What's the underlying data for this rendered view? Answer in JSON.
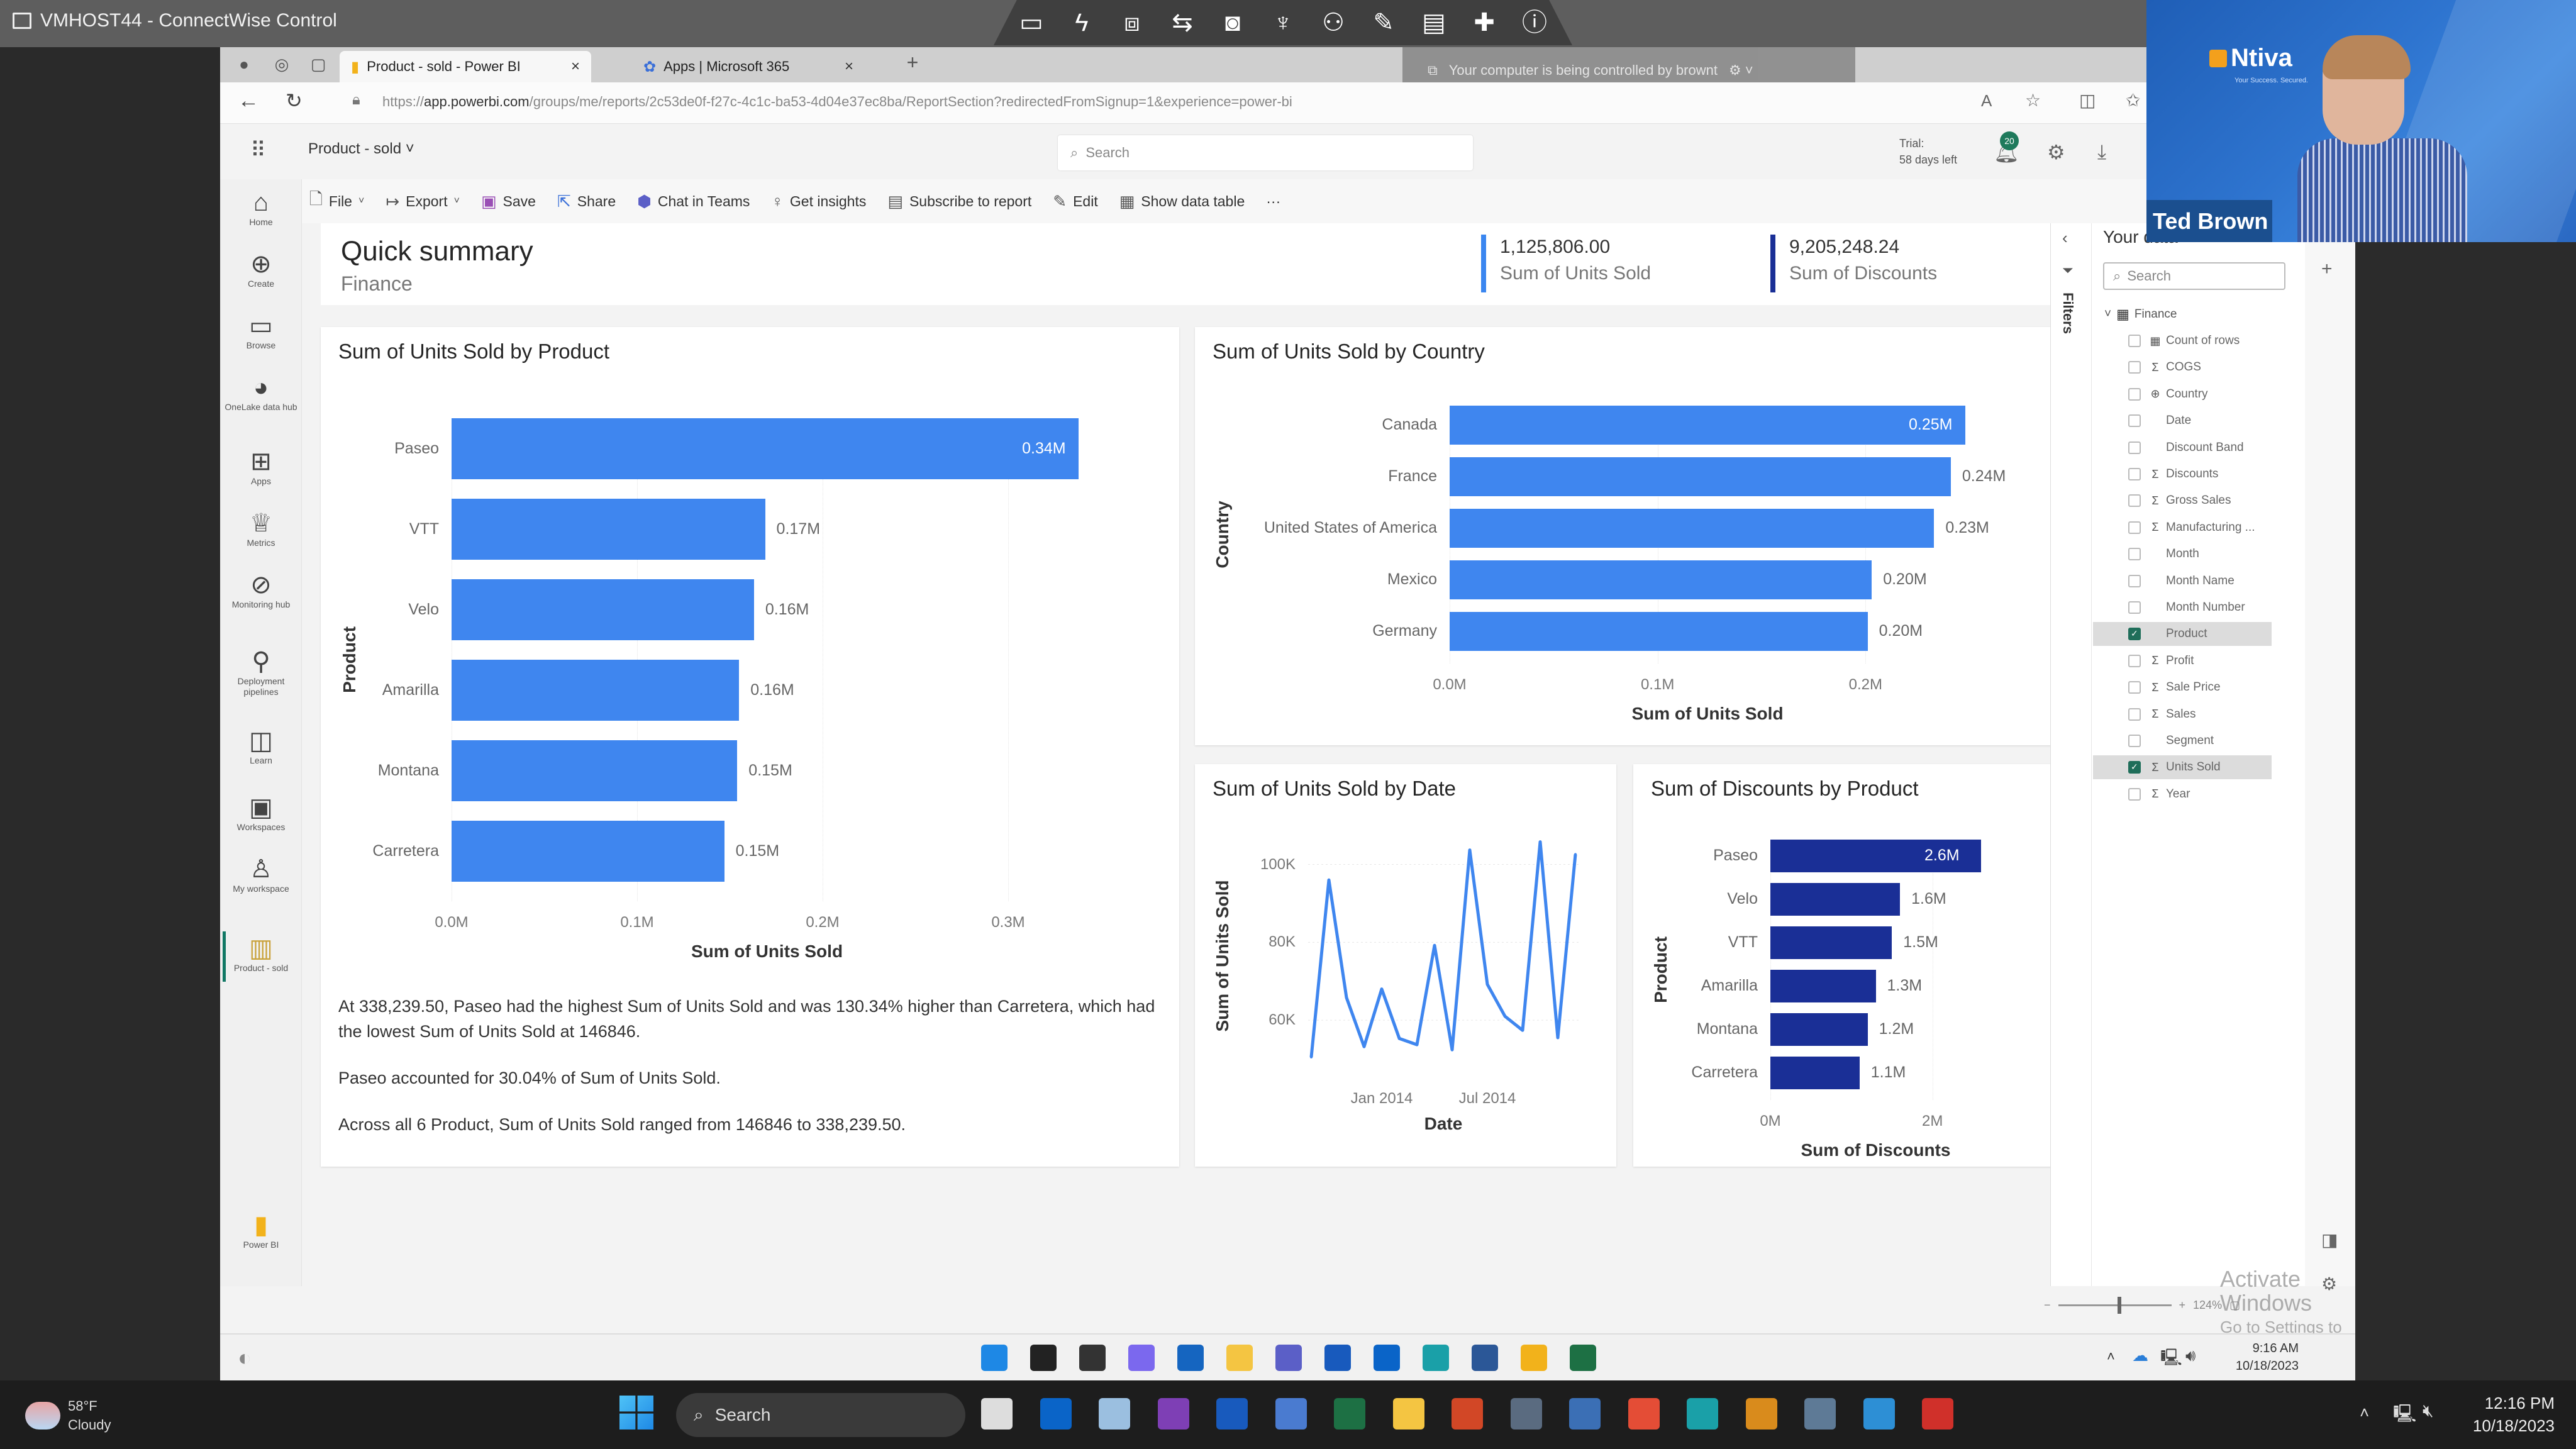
{
  "connectwise": {
    "window_title": "VMHOST44 - ConnectWise Control",
    "toolbar_icons": [
      "monitor-icon",
      "lightning-icon",
      "toolbox-icon",
      "transfer-icon",
      "camera-icon",
      "microphone-icon",
      "participants-icon",
      "pen-icon",
      "chat-icon",
      "plus-icon",
      "info-icon"
    ],
    "control_banner": "Your computer is being controlled by brownt"
  },
  "browser": {
    "tabs": [
      {
        "label": "Product - sold - Power BI",
        "active": true
      },
      {
        "label": "Apps | Microsoft 365",
        "active": false
      }
    ],
    "url_prefix": "https://",
    "url_domain": "app.powerbi.com",
    "url_path": "/groups/me/reports/2c53de0f-f27c-4c1c-ba53-4d04e37ec8ba/ReportSection?redirectedFromSignup=1&experience=power-bi"
  },
  "pbi_header": {
    "report_name": "Product - sold",
    "search_placeholder": "Search",
    "trial_line1": "Trial:",
    "trial_line2": "58 days left",
    "notification_count": "20"
  },
  "toolbar": {
    "items": [
      {
        "label": "File",
        "icon": "file-icon",
        "dropdown": true
      },
      {
        "label": "Export",
        "icon": "export-icon",
        "dropdown": true
      },
      {
        "label": "Save",
        "icon": "save-icon"
      },
      {
        "label": "Share",
        "icon": "share-icon"
      },
      {
        "label": "Chat in Teams",
        "icon": "teams-icon"
      },
      {
        "label": "Get insights",
        "icon": "lightbulb-icon"
      },
      {
        "label": "Subscribe to report",
        "icon": "subscribe-icon"
      },
      {
        "label": "Edit",
        "icon": "pencil-icon"
      },
      {
        "label": "Show data table",
        "icon": "table-icon"
      }
    ],
    "more_label": "···"
  },
  "leftnav": {
    "items": [
      {
        "label": "Home",
        "icon": "home-icon"
      },
      {
        "label": "Create",
        "icon": "create-icon"
      },
      {
        "label": "Browse",
        "icon": "folder-icon"
      },
      {
        "label": "OneLake data hub",
        "icon": "onelake-icon"
      },
      {
        "label": "Apps",
        "icon": "apps-icon"
      },
      {
        "label": "Metrics",
        "icon": "trophy-icon"
      },
      {
        "label": "Monitoring hub",
        "icon": "monitor-hub-icon"
      },
      {
        "label": "Deployment pipelines",
        "icon": "rocket-icon"
      },
      {
        "label": "Learn",
        "icon": "book-icon"
      },
      {
        "label": "Workspaces",
        "icon": "workspaces-icon"
      },
      {
        "label": "My workspace",
        "icon": "person-icon"
      },
      {
        "label": "Product - sold",
        "icon": "report-icon",
        "active": true
      }
    ],
    "brand_label": "Power BI"
  },
  "summary": {
    "title": "Quick summary",
    "subtitle": "Finance",
    "kpis": [
      {
        "value": "1,125,806.00",
        "label": "Sum of Units Sold",
        "color": "#3a86f0"
      },
      {
        "value": "9,205,248.24",
        "label": "Sum of Discounts",
        "color": "#1a2f96"
      }
    ]
  },
  "narrative": [
    "At 338,239.50, Paseo had the highest Sum of Units Sold and was 130.34% higher than Carretera, which had the lowest Sum of Units Sold at 146846.",
    "Paseo accounted for 30.04% of Sum of Units Sold.",
    "Across all 6 Product, Sum of Units Sold ranged from 146846 to 338,239.50."
  ],
  "chart_data": [
    {
      "type": "bar",
      "orientation": "horizontal",
      "title": "Sum of Units Sold by Product",
      "xlabel": "Sum of Units Sold",
      "ylabel": "Product",
      "categories": [
        "Paseo",
        "VTT",
        "Velo",
        "Amarilla",
        "Montana",
        "Carretera"
      ],
      "values": [
        0.338,
        0.169,
        0.163,
        0.155,
        0.154,
        0.147
      ],
      "value_labels": [
        "0.34M",
        "0.17M",
        "0.16M",
        "0.16M",
        "0.15M",
        "0.15M"
      ],
      "xticks": [
        "0.0M",
        "0.1M",
        "0.2M",
        "0.3M"
      ],
      "xlim": [
        0,
        0.34
      ],
      "unit": "M",
      "color": "#3f86ef"
    },
    {
      "type": "bar",
      "orientation": "horizontal",
      "title": "Sum of Units Sold by Country",
      "xlabel": "Sum of Units Sold",
      "ylabel": "Country",
      "categories": [
        "Canada",
        "France",
        "United States of America",
        "Mexico",
        "Germany"
      ],
      "values": [
        0.248,
        0.241,
        0.233,
        0.203,
        0.201
      ],
      "value_labels": [
        "0.25M",
        "0.24M",
        "0.23M",
        "0.20M",
        "0.20M"
      ],
      "xticks": [
        "0.0M",
        "0.1M",
        "0.2M"
      ],
      "xlim": [
        0,
        0.248
      ],
      "unit": "M",
      "color": "#3f86ef"
    },
    {
      "type": "line",
      "title": "Sum of Units Sold by Date",
      "xlabel": "Date",
      "ylabel": "Sum of Units Sold",
      "x": [
        "Sep 2013",
        "Oct 2013",
        "Nov 2013",
        "Dec 2013",
        "Jan 2014",
        "Feb 2014",
        "Mar 2014",
        "Apr 2014",
        "May 2014",
        "Jun 2014",
        "Jul 2014",
        "Aug 2014",
        "Sep 2014",
        "Oct 2014",
        "Nov 2014",
        "Dec 2014"
      ],
      "values": [
        50500,
        96000,
        65800,
        53200,
        68000,
        55300,
        53700,
        79200,
        52400,
        103700,
        69200,
        61000,
        57400,
        105800,
        55500,
        102600
      ],
      "xticks": [
        "Jan 2014",
        "Jul 2014"
      ],
      "yticks": [
        "60K",
        "80K",
        "100K"
      ],
      "ylim": [
        45000,
        108000
      ],
      "grid": true,
      "color": "#3f86ef"
    },
    {
      "type": "bar",
      "orientation": "horizontal",
      "title": "Sum of Discounts by Product",
      "xlabel": "Sum of Discounts",
      "ylabel": "Product",
      "categories": [
        "Paseo",
        "Velo",
        "VTT",
        "Amarilla",
        "Montana",
        "Carretera"
      ],
      "values": [
        2.6,
        1.6,
        1.5,
        1.3,
        1.2,
        1.1
      ],
      "value_labels": [
        "2.6M",
        "1.6M",
        "1.5M",
        "1.3M",
        "1.2M",
        "1.1M"
      ],
      "xticks": [
        "0M",
        "2M"
      ],
      "xlim": [
        0,
        2.6
      ],
      "unit": "M",
      "color": "#1a2f96"
    }
  ],
  "data_pane": {
    "filters_label": "Filters",
    "title": "Your data",
    "search_placeholder": "Search",
    "table_name": "Finance",
    "fields": [
      {
        "name": "Count of rows",
        "type": "calc-icon",
        "checked": false
      },
      {
        "name": "COGS",
        "type": "sigma-icon",
        "checked": false
      },
      {
        "name": "Country",
        "type": "globe-icon",
        "checked": false
      },
      {
        "name": "Date",
        "type": "",
        "checked": false
      },
      {
        "name": "Discount Band",
        "type": "",
        "checked": false
      },
      {
        "name": "Discounts",
        "type": "sigma-icon",
        "checked": false
      },
      {
        "name": "Gross Sales",
        "type": "sigma-icon",
        "checked": false
      },
      {
        "name": "Manufacturing ...",
        "type": "sigma-icon",
        "checked": false
      },
      {
        "name": "Month",
        "type": "",
        "checked": false
      },
      {
        "name": "Month Name",
        "type": "",
        "checked": false
      },
      {
        "name": "Month Number",
        "type": "",
        "checked": false
      },
      {
        "name": "Product",
        "type": "",
        "checked": true
      },
      {
        "name": "Profit",
        "type": "sigma-icon",
        "checked": false
      },
      {
        "name": "Sale Price",
        "type": "sigma-icon",
        "checked": false
      },
      {
        "name": "Sales",
        "type": "sigma-icon",
        "checked": false
      },
      {
        "name": "Segment",
        "type": "",
        "checked": false
      },
      {
        "name": "Units Sold",
        "type": "sigma-icon",
        "checked": true
      },
      {
        "name": "Year",
        "type": "sigma-icon",
        "checked": false
      }
    ]
  },
  "zoom": {
    "level": "124%"
  },
  "watermark": {
    "line1": "Activate Windows",
    "line2": "Go to Settings to activate Windows."
  },
  "remote_taskbar": {
    "time": "9:16 AM",
    "date": "10/18/2023",
    "apps": [
      "start-icon",
      "search-icon",
      "taskview-icon",
      "chat-icon",
      "photos-icon",
      "file-explorer-icon",
      "teams-icon",
      "word-icon",
      "outlook-icon",
      "edge-icon",
      "store-icon",
      "powerbi-icon",
      "excel-icon"
    ]
  },
  "host_taskbar": {
    "weather_temp": "58°F",
    "weather_desc": "Cloudy",
    "weather_badge": "1",
    "search_label": "Search",
    "time": "12:16 PM",
    "date": "10/18/2023",
    "apps": [
      "taskview-icon",
      "outlook-icon",
      "photos-icon",
      "onenote-icon",
      "word-icon",
      "remote-icon",
      "excel-icon",
      "file-explorer-icon",
      "powerpoint-icon",
      "calculator-icon",
      "network-icon",
      "chrome-icon",
      "edge-icon",
      "nimbus-icon",
      "tools-icon",
      "notepad-icon",
      "connectwise-icon"
    ]
  },
  "webcam": {
    "presenter_name": "Ted Brown",
    "logo_text": "Ntiva",
    "logo_tagline": "Your Success. Secured."
  }
}
